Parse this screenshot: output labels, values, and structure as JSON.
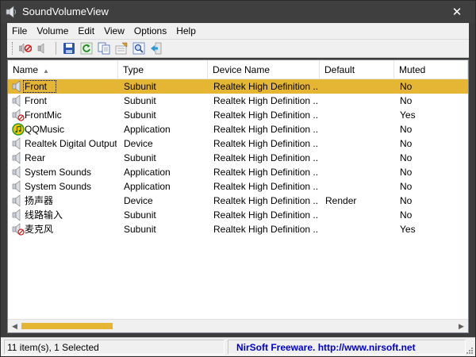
{
  "window": {
    "title": "SoundVolumeView",
    "close_glyph": "✕"
  },
  "menu": [
    "File",
    "Volume",
    "Edit",
    "View",
    "Options",
    "Help"
  ],
  "toolbar": {
    "buttons": [
      "mute-icon",
      "unmute-icon",
      "save-icon",
      "refresh-icon",
      "copy-icon",
      "properties-icon",
      "find-icon",
      "exit-icon"
    ]
  },
  "table": {
    "columns": [
      "Name",
      "Type",
      "Device Name",
      "Default",
      "Muted"
    ],
    "sort_indicator": "▲",
    "rows": [
      {
        "name": "Front",
        "type": "Subunit",
        "device": "Realtek High Definition ...",
        "default": "",
        "muted": "No",
        "icon": "speaker-icon",
        "selected": true
      },
      {
        "name": "Front",
        "type": "Subunit",
        "device": "Realtek High Definition ...",
        "default": "",
        "muted": "No",
        "icon": "speaker-icon"
      },
      {
        "name": "FrontMic",
        "type": "Subunit",
        "device": "Realtek High Definition ...",
        "default": "",
        "muted": "Yes",
        "icon": "speaker-muted-icon"
      },
      {
        "name": "QQMusic",
        "type": "Application",
        "device": "Realtek High Definition ...",
        "default": "",
        "muted": "No",
        "icon": "qqmusic-icon"
      },
      {
        "name": "Realtek Digital Output",
        "type": "Device",
        "device": "Realtek High Definition ...",
        "default": "",
        "muted": "No",
        "icon": "speaker-icon"
      },
      {
        "name": "Rear",
        "type": "Subunit",
        "device": "Realtek High Definition ...",
        "default": "",
        "muted": "No",
        "icon": "speaker-icon"
      },
      {
        "name": "System Sounds",
        "type": "Application",
        "device": "Realtek High Definition ...",
        "default": "",
        "muted": "No",
        "icon": "speaker-icon"
      },
      {
        "name": "System Sounds",
        "type": "Application",
        "device": "Realtek High Definition ...",
        "default": "",
        "muted": "No",
        "icon": "speaker-icon"
      },
      {
        "name": "扬声器",
        "type": "Device",
        "device": "Realtek High Definition ...",
        "default": "Render",
        "muted": "No",
        "icon": "speaker-icon"
      },
      {
        "name": "线路输入",
        "type": "Subunit",
        "device": "Realtek High Definition ...",
        "default": "",
        "muted": "No",
        "icon": "speaker-icon"
      },
      {
        "name": "麦克风",
        "type": "Subunit",
        "device": "Realtek High Definition ...",
        "default": "",
        "muted": "Yes",
        "icon": "speaker-muted-icon"
      }
    ]
  },
  "scrollbar": {
    "left_arrow": "◀",
    "right_arrow": "▶",
    "position_fraction": 0,
    "visible_fraction": 0.21
  },
  "status": {
    "items": "11 item(s), 1 Selected",
    "credit": "NirSoft Freeware.  http://www.nirsoft.net"
  },
  "colors": {
    "selection": "#e5b534",
    "link": "#0000cc"
  }
}
